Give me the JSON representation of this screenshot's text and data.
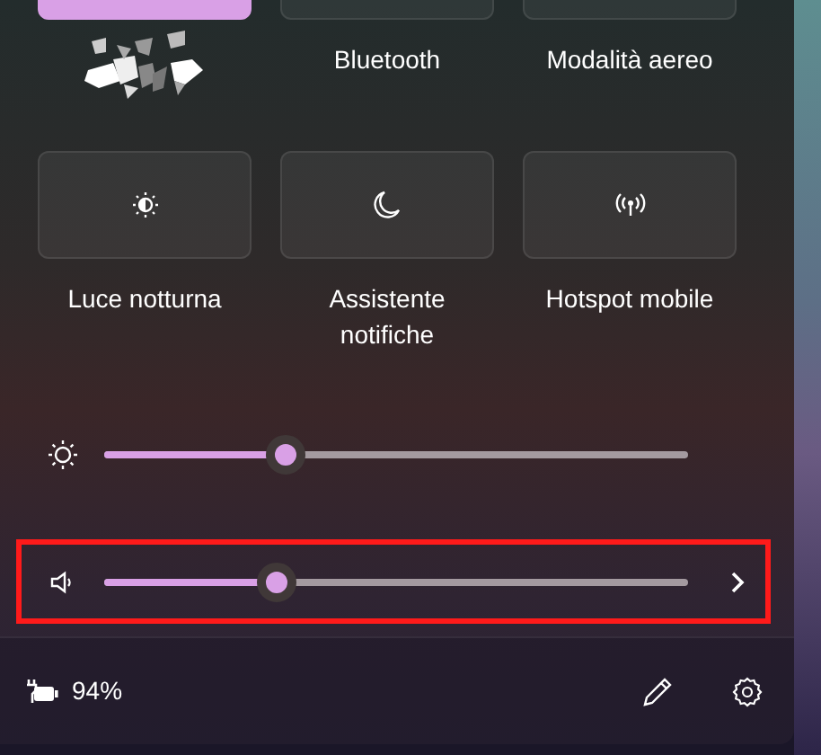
{
  "quick_actions": [
    {
      "kind": "obscured",
      "on": true
    },
    {
      "kind": "toggle",
      "label": "Bluetooth",
      "on": false
    },
    {
      "kind": "toggle",
      "label": "Modalità aereo",
      "on": false
    },
    {
      "kind": "toggle",
      "label": "Luce notturna",
      "on": false
    },
    {
      "kind": "toggle",
      "label": "Assistente notifiche",
      "on": false
    },
    {
      "kind": "toggle",
      "label": "Hotspot mobile",
      "on": false
    }
  ],
  "sliders": [
    {
      "kind": "brightness",
      "level": 0.31,
      "highlighted": false
    },
    {
      "kind": "volume",
      "level": 0.295,
      "highlighted": true
    }
  ],
  "footer": {
    "battery": "94%"
  }
}
